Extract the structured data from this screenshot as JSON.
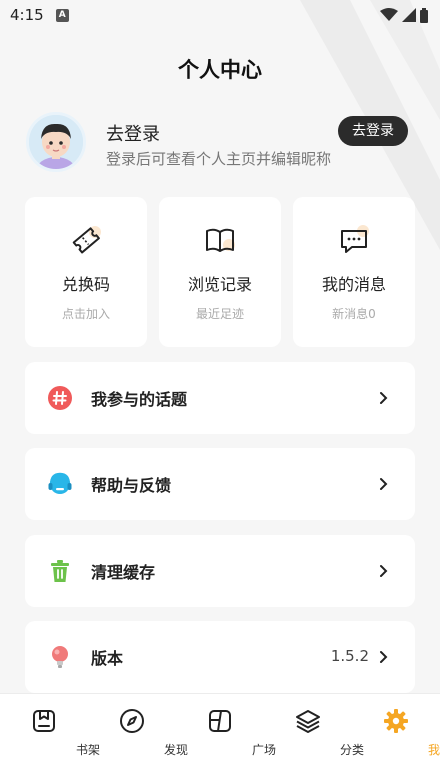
{
  "status_bar": {
    "time": "4:15",
    "notification_icon": "A"
  },
  "header": {
    "title": "个人中心"
  },
  "profile": {
    "title": "去登录",
    "subtitle": "登录后可查看个人主页并编辑昵称",
    "login_button": "去登录"
  },
  "cards": [
    {
      "label": "兑换码",
      "sub": "点击加入",
      "icon": "ticket-icon"
    },
    {
      "label": "浏览记录",
      "sub": "最近足迹",
      "icon": "book-icon"
    },
    {
      "label": "我的消息",
      "sub": "新消息0",
      "icon": "message-icon"
    }
  ],
  "menu": [
    {
      "label": "我参与的话题",
      "icon": "hashtag-icon",
      "color": "#f05a5a"
    },
    {
      "label": "帮助与反馈",
      "icon": "headset-icon",
      "color": "#29b6e8"
    },
    {
      "label": "清理缓存",
      "icon": "trash-icon",
      "color": "#6cc24a"
    },
    {
      "label": "版本",
      "value": "1.5.2",
      "icon": "bulb-icon",
      "color": "#f07a7a"
    }
  ],
  "nav": [
    {
      "label": "书架",
      "icon": "bookshelf-icon"
    },
    {
      "label": "发现",
      "icon": "compass-icon"
    },
    {
      "label": "广场",
      "icon": "square-icon"
    },
    {
      "label": "分类",
      "icon": "layers-icon"
    },
    {
      "label": "我的",
      "icon": "gear-icon",
      "active": true
    }
  ],
  "colors": {
    "accent": "#f5a623",
    "dark_button": "#2b2b2b",
    "background": "#f6f6f6"
  }
}
